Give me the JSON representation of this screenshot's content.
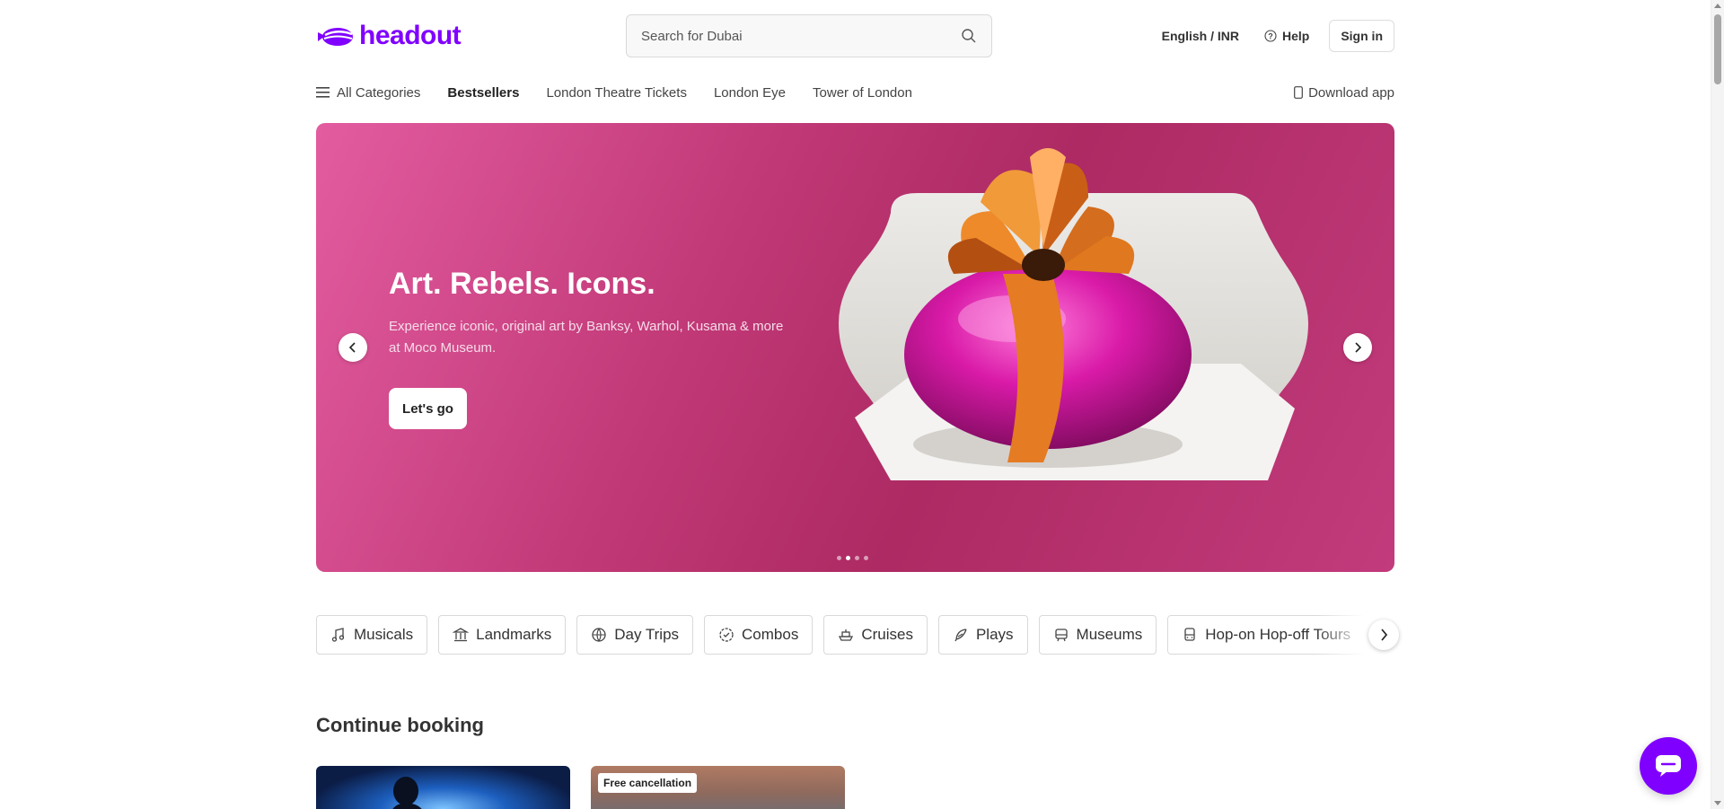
{
  "header": {
    "logo_text": "headout",
    "brand_color": "#8000ff",
    "search": {
      "placeholder": "Search for Dubai"
    },
    "language_currency": "English / INR",
    "help_label": "Help",
    "signin_label": "Sign in"
  },
  "nav": {
    "all_categories": "All Categories",
    "items": [
      {
        "label": "Bestsellers"
      },
      {
        "label": "London Theatre Tickets"
      },
      {
        "label": "London Eye"
      },
      {
        "label": "Tower of London"
      }
    ],
    "download_app": "Download app"
  },
  "hero": {
    "title": "Art. Rebels. Icons.",
    "subtitle": "Experience iconic, original art by Banksy, Warhol, Kusama & more at Moco Museum.",
    "cta_label": "Let's go",
    "background_color": "#c23a78",
    "slide_count": 4,
    "active_slide": 2
  },
  "categories": [
    {
      "label": "Musicals",
      "icon": "music-note-icon"
    },
    {
      "label": "Landmarks",
      "icon": "landmark-icon"
    },
    {
      "label": "Day Trips",
      "icon": "globe-icon"
    },
    {
      "label": "Combos",
      "icon": "badge-icon"
    },
    {
      "label": "Cruises",
      "icon": "ship-icon"
    },
    {
      "label": "Plays",
      "icon": "feather-icon"
    },
    {
      "label": "Museums",
      "icon": "museum-icon"
    },
    {
      "label": "Hop-on Hop-off Tours",
      "icon": "bus-icon"
    }
  ],
  "continue_booking": {
    "title": "Continue booking",
    "cards": [
      {
        "badge": ""
      },
      {
        "badge": "Free cancellation"
      }
    ]
  }
}
